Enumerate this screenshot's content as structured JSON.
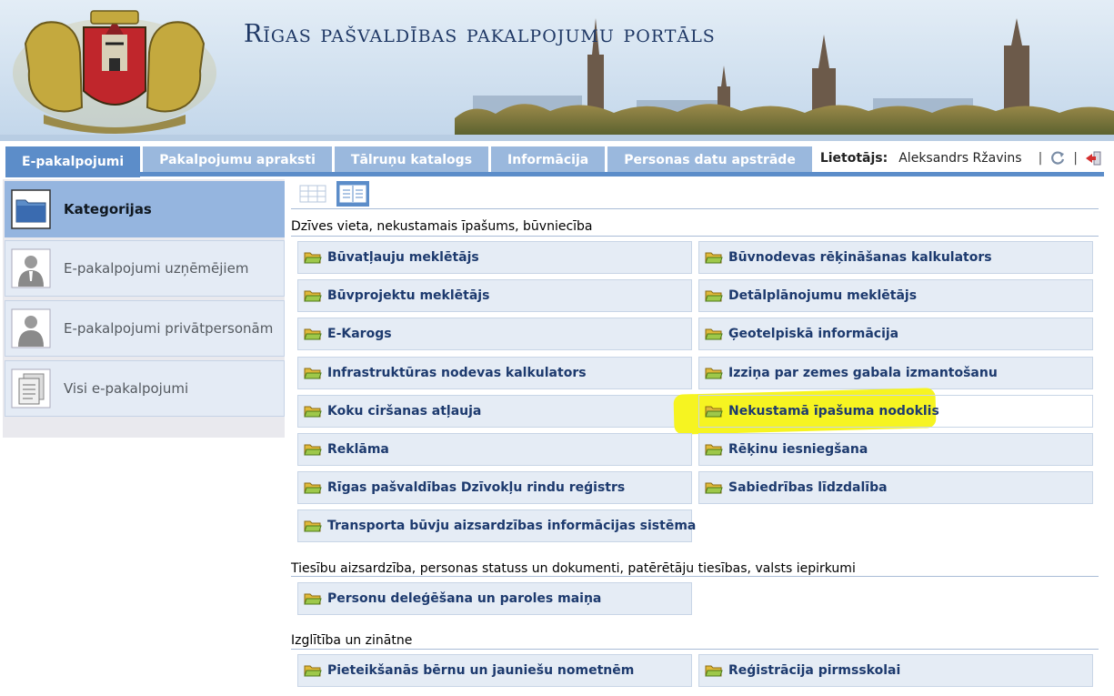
{
  "banner": {
    "title": "Rīgas pašvaldības pakalpojumu portāls",
    "logo": "riga-coat-of-arms"
  },
  "nav": {
    "tabs": [
      {
        "label": "E-pakalpojumi",
        "active": true
      },
      {
        "label": "Pakalpojumu apraksti",
        "active": false
      },
      {
        "label": "Tālruņu katalogs",
        "active": false
      },
      {
        "label": "Informācija",
        "active": false
      },
      {
        "label": "Personas datu apstrāde",
        "active": false
      }
    ],
    "user_label": "Lietotājs:",
    "user_name": "Aleksandrs Ržavins",
    "separator": "|",
    "icons": [
      "refresh-icon",
      "logout-icon"
    ]
  },
  "sidebar": {
    "items": [
      {
        "label": "Kategorijas",
        "icon": "folder-icon",
        "active": true
      },
      {
        "label": "E-pakalpojumi uzņēmējiem",
        "icon": "businessman-icon",
        "active": false
      },
      {
        "label": "E-pakalpojumi privātpersonām",
        "icon": "person-icon",
        "active": false
      },
      {
        "label": "Visi e-pakalpojumi",
        "icon": "documents-icon",
        "active": false
      }
    ]
  },
  "view_toggle": {
    "options": [
      {
        "icon": "table-view-icon",
        "active": false
      },
      {
        "icon": "list-view-icon",
        "active": true
      }
    ]
  },
  "sections": [
    {
      "title": "Dzīves vieta, nekustamais īpašums, būvniecība",
      "services": [
        "Būvatļauju meklētājs",
        "Būvnodevas rēķināšanas kalkulators",
        "Būvprojektu meklētājs",
        "Detālplānojumu meklētājs",
        "E-Karogs",
        "Ģeotelpiskā informācija",
        "Infrastruktūras nodevas kalkulators",
        "Izziņa par zemes gabala izmantošanu",
        "Koku ciršanas atļauja",
        "Nekustamā īpašuma nodoklis",
        "Reklāma",
        "Rēķinu iesniegšana",
        "Rīgas pašvaldības Dzīvokļu rindu reģistrs",
        "Sabiedrības līdzdalība",
        "Transporta būvju aizsardzības informācijas sistēma"
      ]
    },
    {
      "title": "Tiesību aizsardzība, personas statuss un dokumenti, patērētāju tiesības, valsts iepirkumi",
      "services": [
        "Personu deleģēšana un paroles maiņa"
      ]
    },
    {
      "title": "Izglītība un zinātne",
      "services": [
        "Pieteikšanās bērnu un jauniešu nometnēm",
        "Reģistrācija pirmsskolai"
      ]
    }
  ],
  "highlighted_service": "Nekustamā īpašuma nodoklis",
  "colors": {
    "tab_active": "#5c8dc9",
    "tab_inactive": "#9ab8dd",
    "tile_bg": "#e5ecf5",
    "tile_text": "#1d3a6e",
    "highlight": "#f6f421",
    "title_text": "#1f3865"
  }
}
